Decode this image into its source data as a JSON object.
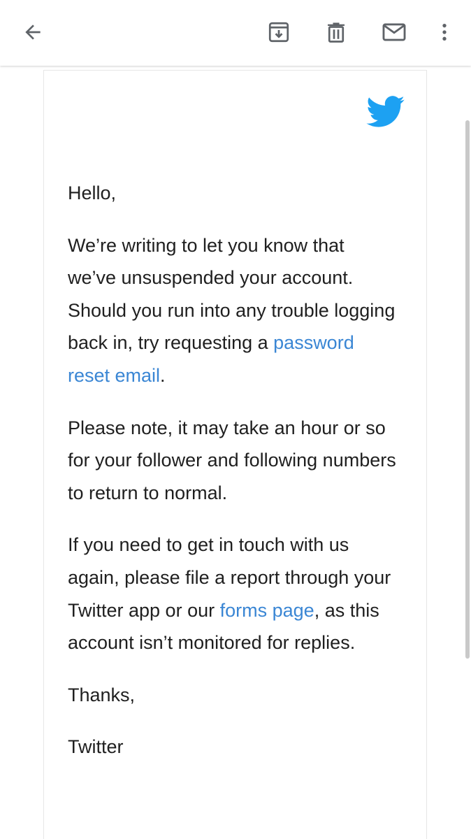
{
  "toolbar": {
    "icons": {
      "back": "arrow-left-icon",
      "archive": "archive-icon",
      "delete": "trash-icon",
      "mark_unread": "mail-icon",
      "more": "more-vertical-icon"
    }
  },
  "email": {
    "sender_logo": "twitter-bird-icon",
    "greeting": "Hello,",
    "paragraph1": {
      "text": "We’re writing to let you know that we’ve unsuspended your account. Should you run into any trouble logging back in, try requesting a ",
      "link": "password reset email",
      "after": "."
    },
    "paragraph2": "Please note, it may take an hour or so for your follower and following numbers to return to normal.",
    "paragraph3": {
      "text": "If you need to get in touch with us again, please file a report through your Twitter app or our ",
      "link": "forms page",
      "after": ", as this account isn’t monitored for replies."
    },
    "closing": "Thanks,",
    "signature": "Twitter"
  },
  "colors": {
    "twitter_blue": "#1da1f2",
    "link": "#3a86d4",
    "icon_gray": "#5f6368",
    "text": "#1f1f1f"
  }
}
